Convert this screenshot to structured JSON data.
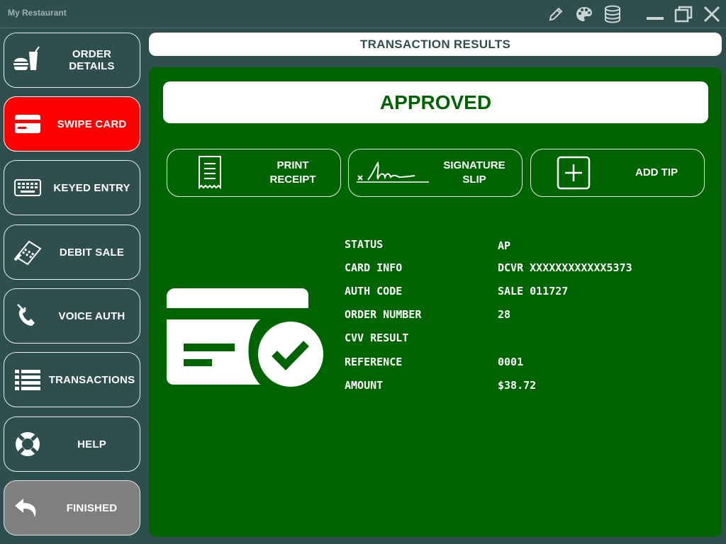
{
  "app": {
    "title": "My Restaurant"
  },
  "window_controls": [
    "edit-icon",
    "palette-icon",
    "database-icon",
    "minimize-icon",
    "restore-icon",
    "close-icon"
  ],
  "sidebar": {
    "items": [
      {
        "label": "ORDER DETAILS",
        "icon": "food-drink-icon"
      },
      {
        "label": "SWIPE CARD",
        "icon": "credit-card-icon",
        "active": true
      },
      {
        "label": "KEYED ENTRY",
        "icon": "keyboard-icon"
      },
      {
        "label": "DEBIT SALE",
        "icon": "card-terminal-icon"
      },
      {
        "label": "VOICE AUTH",
        "icon": "phone-call-icon"
      },
      {
        "label": "TRANSACTIONS",
        "icon": "list-icon"
      },
      {
        "label": "HELP",
        "icon": "lifebuoy-icon"
      },
      {
        "label": "FINISHED",
        "icon": "back-arrow-icon"
      }
    ]
  },
  "header": {
    "title": "TRANSACTION RESULTS"
  },
  "result": {
    "status_banner": "APPROVED"
  },
  "actions": {
    "print_receipt": "PRINT RECEIPT",
    "signature_slip_line1": "SIGNATURE",
    "signature_slip_line2": "SLIP",
    "add_tip": "ADD TIP"
  },
  "details": [
    {
      "label": "STATUS",
      "value": "AP"
    },
    {
      "label": "CARD INFO",
      "value": "DCVR XXXXXXXXXXXX5373"
    },
    {
      "label": "AUTH CODE",
      "value": "SALE 011727"
    },
    {
      "label": "ORDER NUMBER",
      "value": "28"
    },
    {
      "label": "CVV RESULT",
      "value": ""
    },
    {
      "label": "REFERENCE",
      "value": "0001"
    },
    {
      "label": "AMOUNT",
      "value": "$38.72"
    }
  ],
  "colors": {
    "background": "#2f4f4f",
    "panel": "#006400",
    "active": "#ff0000",
    "finished": "#7f7f7f"
  }
}
